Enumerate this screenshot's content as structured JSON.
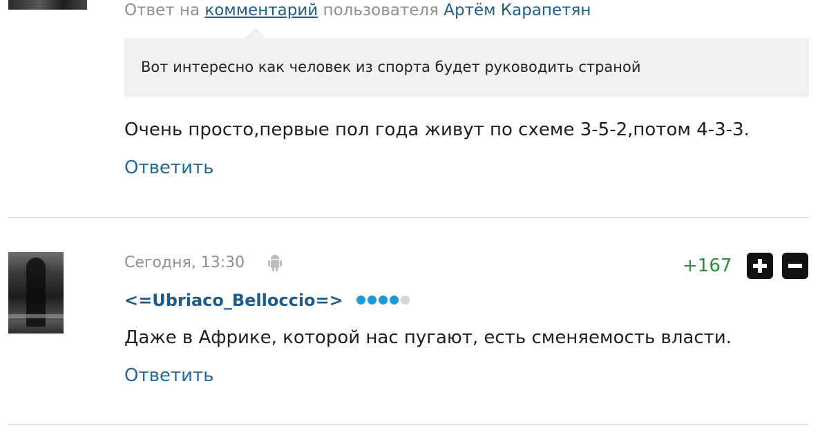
{
  "comment_top": {
    "reply_prefix": "Ответ на",
    "reply_link": "комментарий",
    "reply_middle": "пользователя",
    "reply_user": "Артём Карапетян",
    "quote": "Вот интересно как человек из спорта будет руководить страной",
    "body": "Очень просто,первые пол года живут по схеме 3-5-2,потом 4-3-3.",
    "reply_label": "Ответить"
  },
  "comment_second": {
    "timestamp": "Сегодня, 13:30",
    "device_icon": "android-icon",
    "score": "+167",
    "username": "<=Ubriaco_Belloccio=>",
    "rank_dots_filled": 4,
    "rank_dots_total": 5,
    "body": "Даже в Африке, которой нас пугают, есть сменяемость власти.",
    "reply_label": "Ответить"
  },
  "colors": {
    "link": "#26699a",
    "username": "#1e5b87",
    "score_positive": "#2d8f3b",
    "rank_dot": "#1a9ad9",
    "quote_bg": "#f0f0ee"
  }
}
